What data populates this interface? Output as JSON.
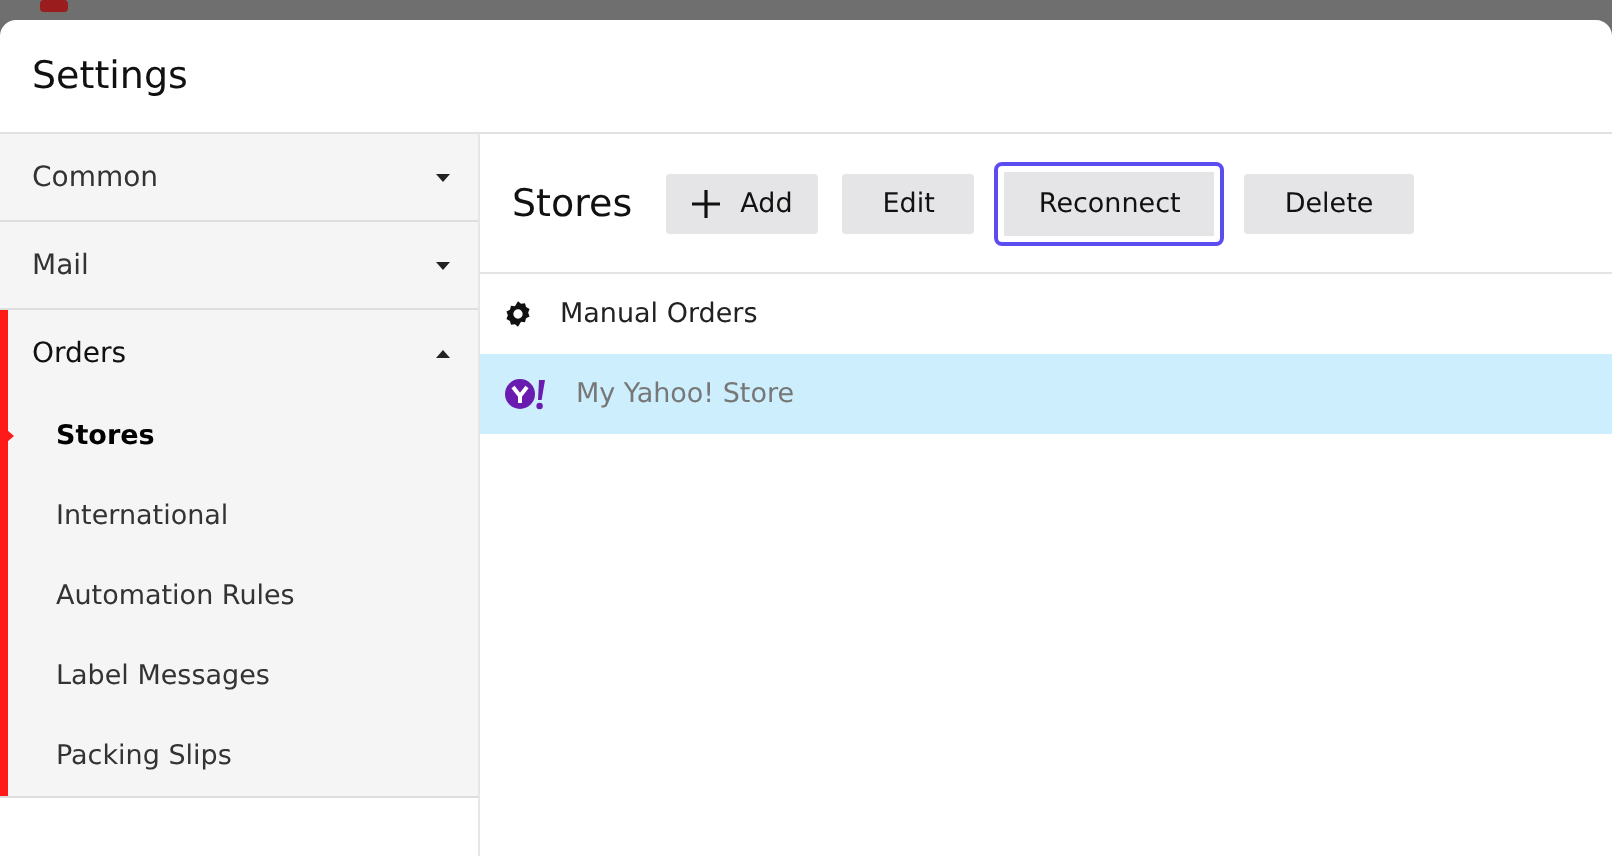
{
  "window": {
    "title": "Settings"
  },
  "sidebar": {
    "sections": [
      {
        "label": "Common",
        "expanded": false
      },
      {
        "label": "Mail",
        "expanded": false
      },
      {
        "label": "Orders",
        "expanded": true,
        "children": [
          {
            "label": "Stores",
            "selected": true
          },
          {
            "label": "International",
            "selected": false
          },
          {
            "label": "Automation Rules",
            "selected": false
          },
          {
            "label": "Label Messages",
            "selected": false
          },
          {
            "label": "Packing Slips",
            "selected": false
          }
        ]
      }
    ]
  },
  "panel": {
    "title": "Stores",
    "buttons": [
      {
        "label": "Add",
        "kind": "add",
        "focused": false
      },
      {
        "label": "Edit",
        "kind": "plain",
        "focused": false
      },
      {
        "label": "Reconnect",
        "kind": "plain",
        "focused": true
      },
      {
        "label": "Delete",
        "kind": "plain",
        "focused": false
      }
    ],
    "stores": [
      {
        "name": "Manual Orders",
        "kind": "manual",
        "selected": false
      },
      {
        "name": "My Yahoo! Store",
        "kind": "yahoo",
        "selected": true
      }
    ]
  }
}
